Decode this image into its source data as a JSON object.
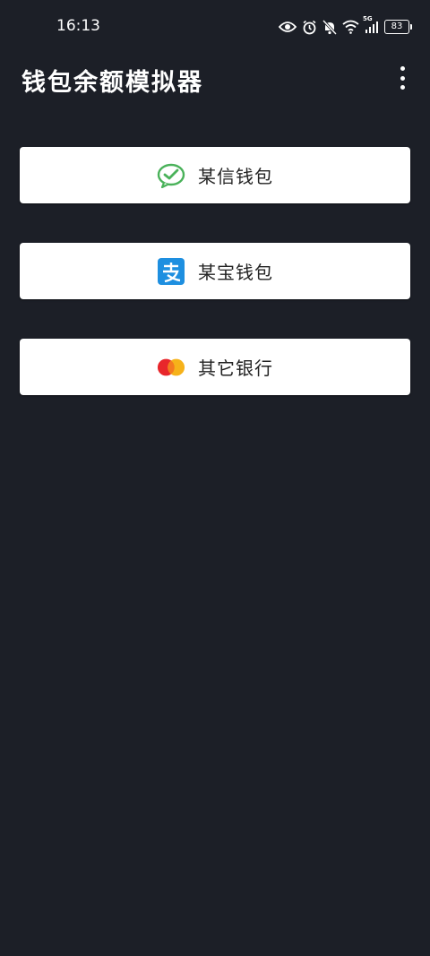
{
  "status_bar": {
    "time": "16:13",
    "battery": "83",
    "network": "5G"
  },
  "app_bar": {
    "title": "钱包余额模拟器",
    "menu_icon": "more-vertical-icon"
  },
  "wallets": [
    {
      "label": "某信钱包",
      "icon": "wechat-icon",
      "color": "#4ab25a"
    },
    {
      "label": "某宝钱包",
      "icon": "alipay-icon",
      "color": "#1e8fe0"
    },
    {
      "label": "其它银行",
      "icon": "mastercard-icon",
      "color": "#e8262b"
    }
  ],
  "colors": {
    "background": "#1c1f27",
    "card": "#ffffff",
    "text_dark": "#222222"
  }
}
